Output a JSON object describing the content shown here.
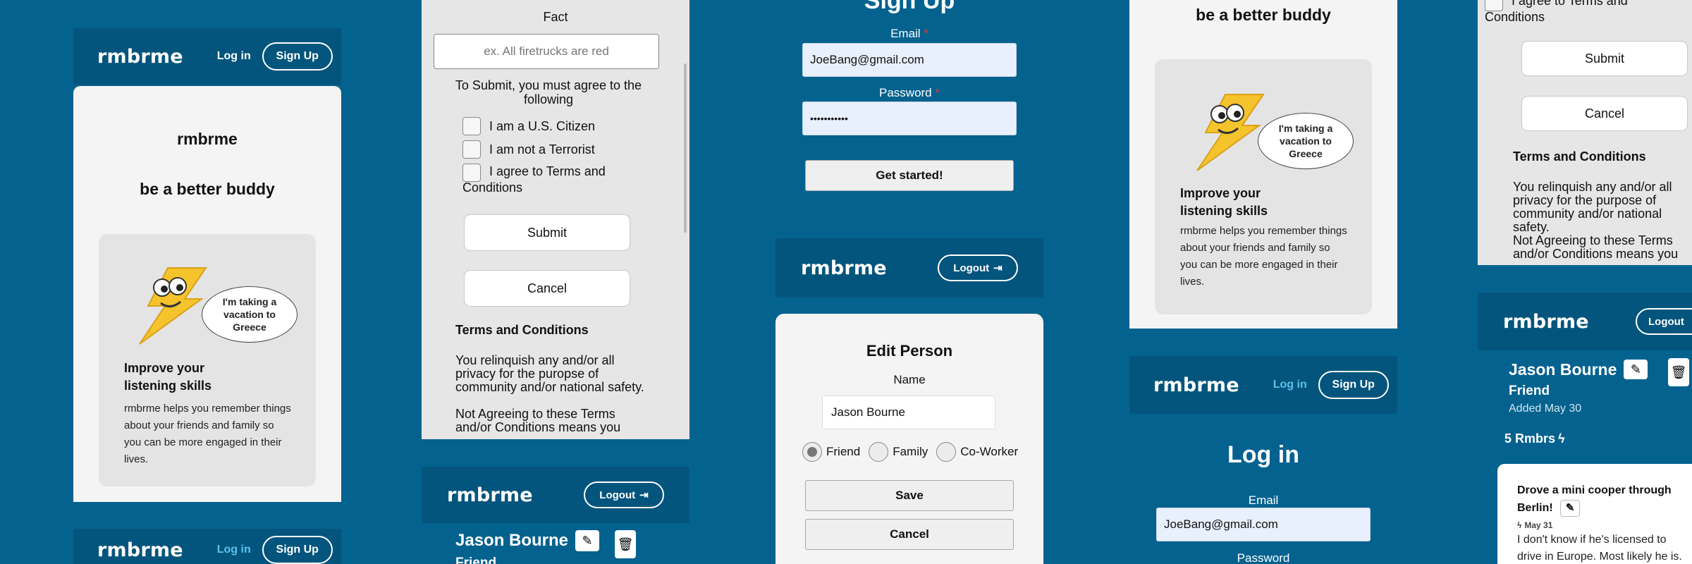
{
  "app": {
    "brand": "rmbrme",
    "tagline": "be a better buddy"
  },
  "nav": {
    "login": "Log in",
    "signup": "Sign Up",
    "logout": "Logout"
  },
  "feature": {
    "bubble": "I'm taking a vacation to Greece",
    "title": "Improve your listening skills",
    "desc": "rmbrme helps you remember things about your friends and family so you can be more engaged in their lives."
  },
  "fact_form": {
    "label": "Fact",
    "placeholder": "ex. All firetrucks are red",
    "agree_text": "To Submit, you must agree to the following",
    "checks": [
      "I am a U.S. Citizen",
      "I am not a Terrorist",
      "I agree to Terms and Conditions"
    ],
    "submit": "Submit",
    "cancel": "Cancel",
    "terms_title": "Terms and Conditions",
    "terms_body": "You relinquish any and/or all privacy for the puropse of community and/or national safety.",
    "terms_body2": "Not Agreeing to these Terms and/or Conditions means you"
  },
  "fact_form_right": {
    "check_partial": "I agree to Terms and Conditions",
    "submit": "Submit",
    "cancel": "Cancel",
    "terms_title": "Terms and Conditions",
    "terms_body": "You relinquish any and/or all privacy for the purpose of community and/or national safety.",
    "terms_body2": "Not Agreeing to these Terms and/or Conditions means you"
  },
  "signup_form": {
    "title": "Sign Up",
    "email_label": "Email",
    "email_value": "JoeBang@gmail.com",
    "password_label": "Password",
    "password_value": "•••••••••••",
    "button": "Get started!"
  },
  "edit_person": {
    "title": "Edit Person",
    "name_label": "Name",
    "name_value": "Jason Bourne",
    "relations": [
      "Friend",
      "Family",
      "Co-Worker"
    ],
    "selected": "Friend",
    "save": "Save",
    "cancel": "Cancel"
  },
  "login_form": {
    "title": "Log in",
    "email_label": "Email",
    "email_value": "JoeBang@gmail.com",
    "password_label": "Password"
  },
  "person": {
    "name": "Jason Bourne",
    "relation": "Friend",
    "added": "Added May 30",
    "rmbrs": "5 Rmbrs",
    "rmbr_title": "Drove a mini cooper through Berlin!",
    "rmbr_date": "May 31",
    "rmbr_body": "I don't know if he's licensed to drive in Europe. Most likely he is."
  },
  "colors": {
    "background": "#04628f",
    "header": "#04557d",
    "accent": "#5bc3ee"
  }
}
